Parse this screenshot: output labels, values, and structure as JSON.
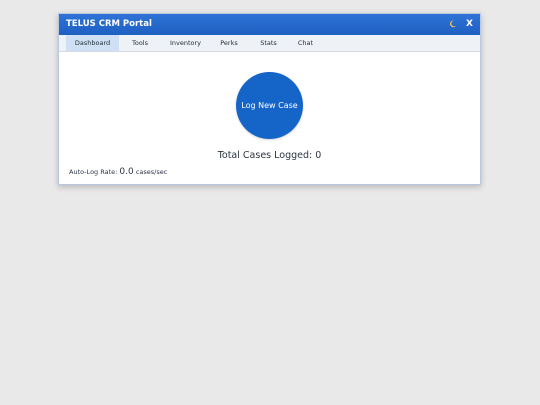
{
  "app": {
    "title": "TELUS CRM Portal",
    "theme_icon": "moon-icon",
    "close_label": "X"
  },
  "tabs": [
    {
      "label": "Dashboard",
      "active": true
    },
    {
      "label": "Tools",
      "active": false
    },
    {
      "label": "Inventory",
      "active": false
    },
    {
      "label": "Perks",
      "active": false
    },
    {
      "label": "Stats",
      "active": false
    },
    {
      "label": "Chat",
      "active": false
    }
  ],
  "dashboard": {
    "log_button_label": "Log New Case",
    "total_label": "Total Cases Logged:",
    "total_value": "0",
    "rate_label": "Auto-Log Rate:",
    "rate_value": "0.0",
    "rate_unit": "cases/sec"
  },
  "colors": {
    "title_bar": "#1e5fc2",
    "accent_button": "#1565c9",
    "active_tab": "#cfe0f4",
    "background": "#e9e9e9"
  }
}
